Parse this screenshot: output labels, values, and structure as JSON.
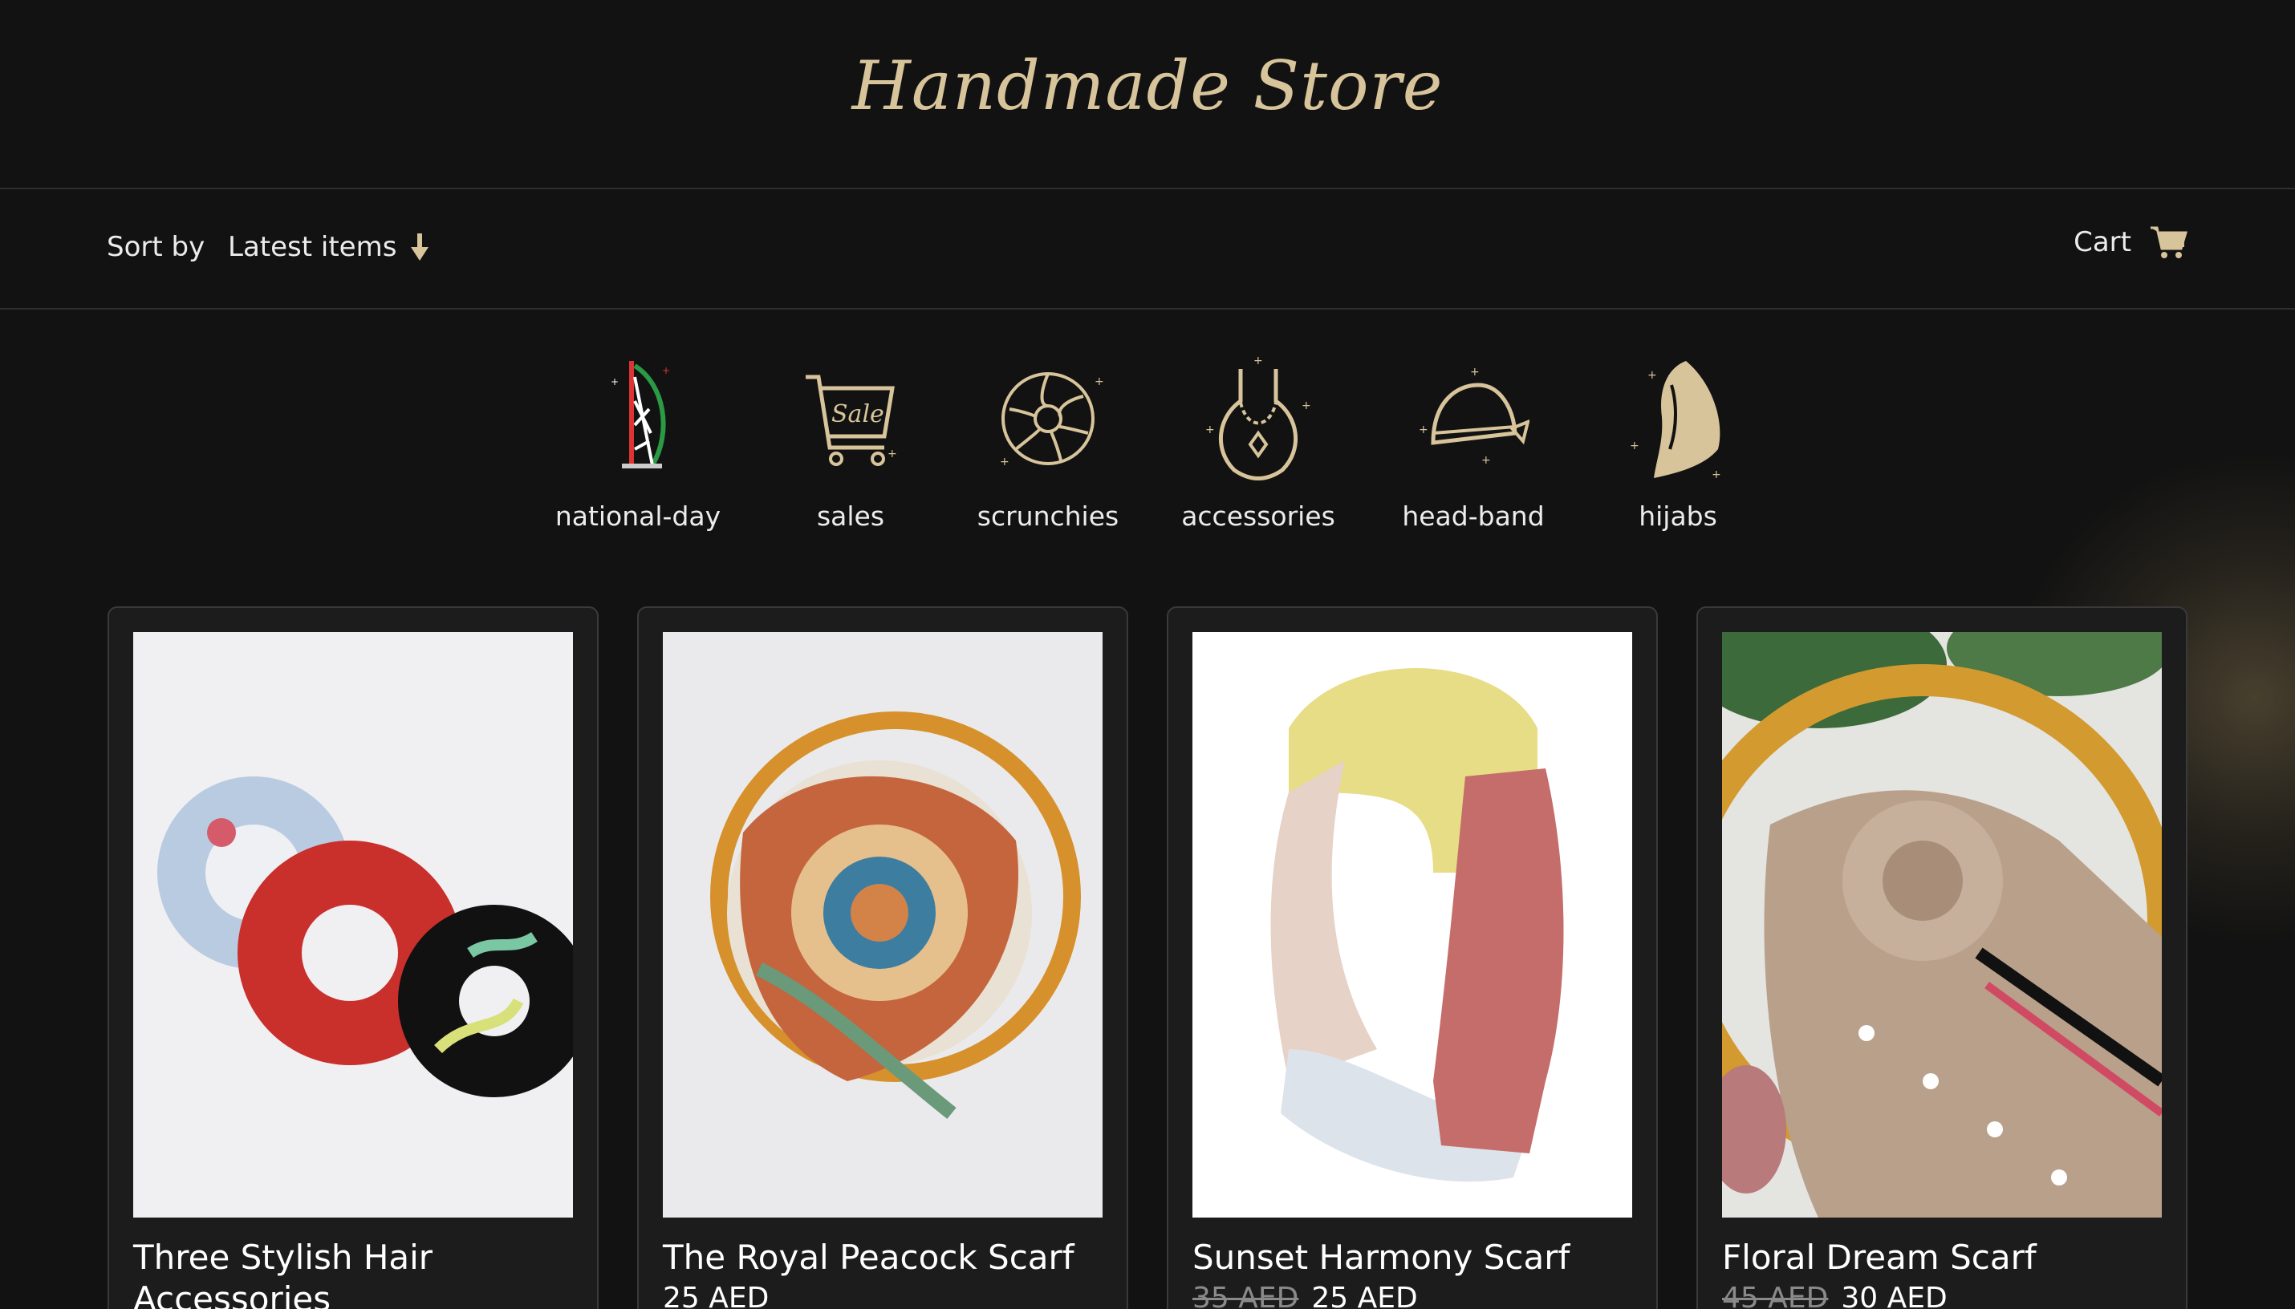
{
  "header": {
    "logo_text": "Handmade Store"
  },
  "toolbar": {
    "sort_label": "Sort by",
    "sort_value": "Latest items",
    "cart_label": "Cart"
  },
  "categories": [
    {
      "label": "national-day",
      "icon": "burj-al-arab-icon"
    },
    {
      "label": "sales",
      "icon": "sale-cart-icon"
    },
    {
      "label": "scrunchies",
      "icon": "scrunchie-icon"
    },
    {
      "label": "accessories",
      "icon": "necklace-icon"
    },
    {
      "label": "head-band",
      "icon": "head-band-icon"
    },
    {
      "label": "hijabs",
      "icon": "hijab-icon"
    }
  ],
  "products": [
    {
      "title": "Three Stylish Hair Accessories",
      "price": "",
      "old_price": ""
    },
    {
      "title": "The Royal Peacock Scarf",
      "price": "25 AED",
      "old_price": ""
    },
    {
      "title": "Sunset Harmony Scarf",
      "price": "25 AED",
      "old_price": "35 AED"
    },
    {
      "title": "Floral Dream Scarf",
      "price": "30 AED",
      "old_price": "45 AED"
    }
  ],
  "colors": {
    "background": "#121212",
    "accent_gold": "#d8c49b",
    "card": "#1c1c1c",
    "card_border": "#3a3a3a"
  }
}
